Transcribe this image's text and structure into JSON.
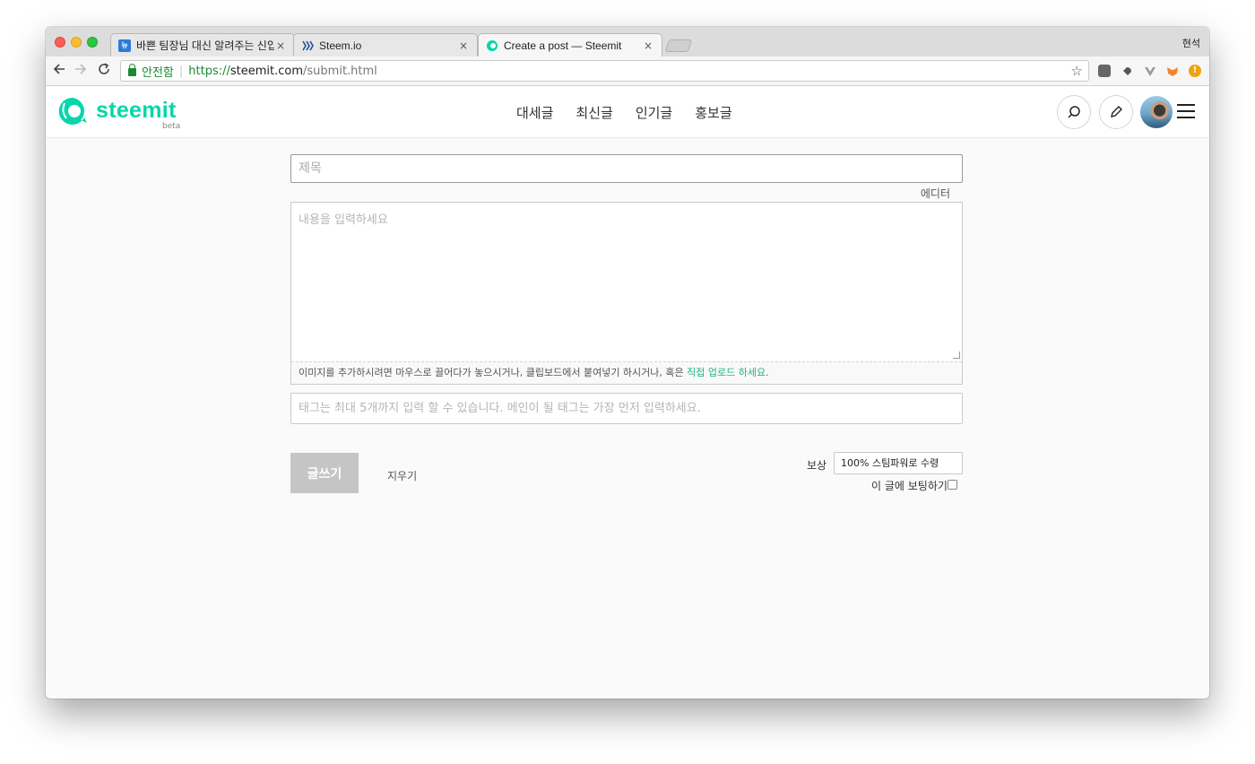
{
  "browser": {
    "tabs": [
      {
        "title": "바쁜 팀장님 대신 알려주는 신입 PHP",
        "favicon": "news-favicon"
      },
      {
        "title": "Steem.io",
        "favicon": "steem-favicon"
      },
      {
        "title": "Create a post — Steemit",
        "favicon": "steemit-favicon",
        "active": true
      }
    ],
    "close_glyph": "×",
    "profile_name": "현석",
    "security_label": "안전함",
    "url": {
      "scheme": "https://",
      "host": "steemit.com",
      "path": "/submit.html"
    }
  },
  "site": {
    "logo_text": "steemit",
    "logo_badge": "beta",
    "nav": [
      "대세글",
      "최신글",
      "인기글",
      "홍보글"
    ],
    "brand_color": "#06d6a9"
  },
  "form": {
    "title_placeholder": "제목",
    "editor_toggle": "에디터",
    "body_placeholder": "내용을 입력하세요",
    "dropzone_text": "이미지를 추가하시려면 마우스로 끌어다가 놓으시거나, 클립보드에서 붙여넣기 하시거나, 혹은",
    "dropzone_link": "직접 업로드 하세요",
    "dropzone_end": ".",
    "tags_placeholder": "태그는 최대 5개까지 입력 할 수 있습니다. 메인이 될 태그는 가장 먼저 입력하세요.",
    "submit_label": "글쓰기",
    "clear_label": "지우기",
    "reward_label": "보상",
    "reward_value": "100% 스팀파워로 수령",
    "vote_label": "이 글에 보팅하기"
  }
}
